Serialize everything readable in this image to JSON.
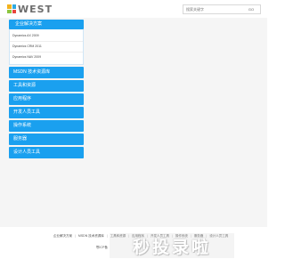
{
  "header": {
    "logo_text": "WEST",
    "search": {
      "placeholder": "搜索关键字",
      "button_label": "GO"
    }
  },
  "sidebar": {
    "group": {
      "title": "企业解决方案",
      "items": [
        "Dynamics AX 2009",
        "Dynamics CRM 2011",
        "Dynamics NAV 2009"
      ]
    },
    "nav": [
      "MSDN 技术资源库",
      "工具和资源",
      "应用程序",
      "开发人员工具",
      "操作系统",
      "服务器",
      "设计人员工具"
    ]
  },
  "footer": {
    "links": [
      "企业解决方案",
      "MSDN 技术资源库",
      "工具和资源",
      "应用程序",
      "开发人员工具",
      "操作系统",
      "服务器",
      "设计人员工具"
    ],
    "copyright": "鄂ICP备"
  },
  "watermark": "秒投录啦",
  "colors": {
    "accent": "#1aa0ef",
    "logo_squares": [
      "#f3b21c",
      "#2fa9e0",
      "#8cc63f",
      "#e8453c"
    ]
  }
}
